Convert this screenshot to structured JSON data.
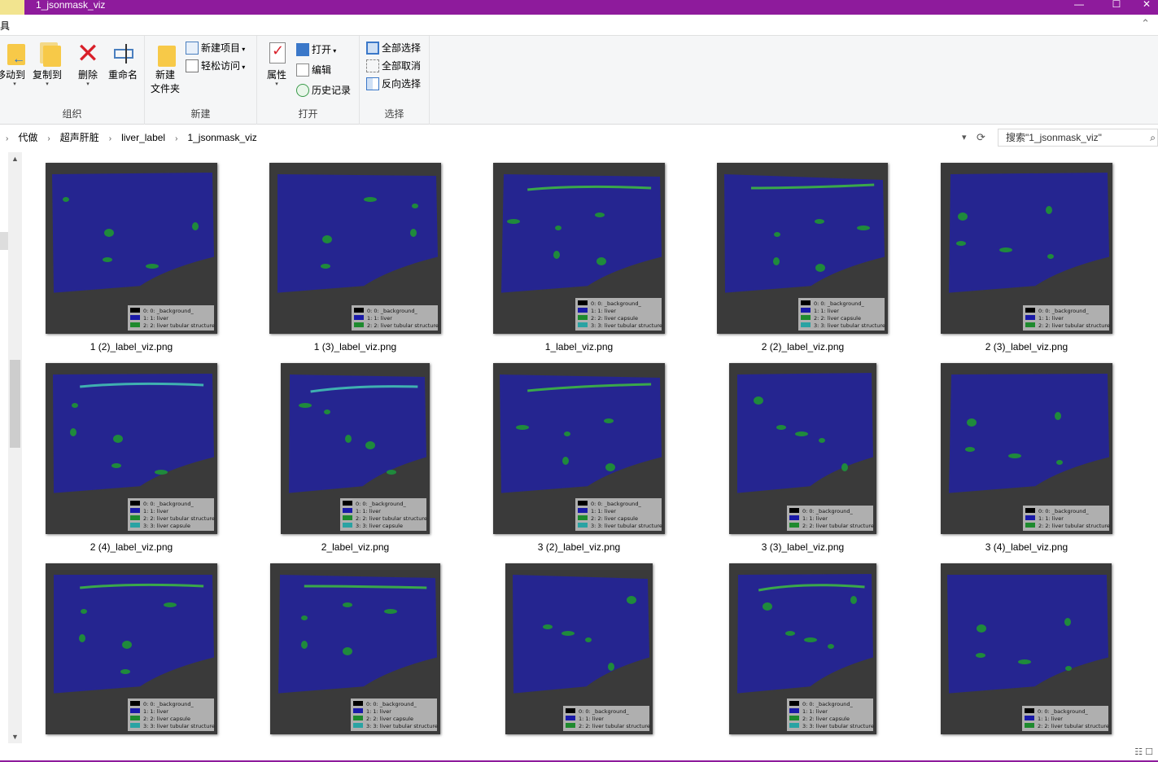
{
  "window": {
    "title": "1_jsonmask_viz"
  },
  "menu": {
    "tab_label": "工具"
  },
  "ribbon": {
    "groups": {
      "organize": "组织",
      "new": "新建",
      "open": "打开",
      "select": "选择"
    },
    "organize": {
      "move_to": "移动到",
      "copy_to": "复制到",
      "delete": "删除",
      "rename": "重命名"
    },
    "new": {
      "new_folder_line1": "新建",
      "new_folder_line2": "文件夹",
      "new_item": "新建项目",
      "easy_access": "轻松访问"
    },
    "open": {
      "properties": "属性",
      "open": "打开",
      "edit": "编辑",
      "history": "历史记录"
    },
    "select": {
      "select_all": "全部选择",
      "select_none": "全部取消",
      "invert": "反向选择"
    }
  },
  "breadcrumb": [
    "代做",
    "超声肝脏",
    "liver_label",
    "1_jsonmask_viz"
  ],
  "search": {
    "placeholder": "搜索\"1_jsonmask_viz\""
  },
  "legend_text": {
    "bg": "0: 0: _background_",
    "liver": "1: 1: liver",
    "tub": "2: 2: liver tubular structure",
    "cap2": "2: 2: liver capsule",
    "cap3": "3: 3: liver capsule",
    "tub3": "3: 3: liver tubular structure"
  },
  "files": [
    {
      "name": "1 (2)_label_viz.png",
      "legend": [
        "bg",
        "liver",
        "tub"
      ]
    },
    {
      "name": "1 (3)_label_viz.png",
      "legend": [
        "bg",
        "liver",
        "tub"
      ]
    },
    {
      "name": "1_label_viz.png",
      "legend": [
        "bg",
        "liver",
        "cap2",
        "tub3"
      ]
    },
    {
      "name": "2 (2)_label_viz.png",
      "legend": [
        "bg",
        "liver",
        "cap2",
        "tub3"
      ]
    },
    {
      "name": "2 (3)_label_viz.png",
      "legend": [
        "bg",
        "liver",
        "tub"
      ]
    },
    {
      "name": "2 (4)_label_viz.png",
      "legend": [
        "bg",
        "liver",
        "tub",
        "cap3"
      ]
    },
    {
      "name": "2_label_viz.png",
      "legend": [
        "bg",
        "liver",
        "tub",
        "cap3"
      ]
    },
    {
      "name": "3 (2)_label_viz.png",
      "legend": [
        "bg",
        "liver",
        "cap2",
        "tub3"
      ]
    },
    {
      "name": "3 (3)_label_viz.png",
      "legend": [
        "bg",
        "liver",
        "tub"
      ]
    },
    {
      "name": "3 (4)_label_viz.png",
      "legend": [
        "bg",
        "liver",
        "tub"
      ]
    },
    {
      "name": "",
      "legend": [
        "bg",
        "liver",
        "cap2",
        "tub3"
      ]
    },
    {
      "name": "",
      "legend": [
        "bg",
        "liver",
        "cap2",
        "tub3"
      ]
    },
    {
      "name": "",
      "legend": [
        "bg",
        "liver",
        "tub"
      ]
    },
    {
      "name": "",
      "legend": [
        "bg",
        "liver",
        "cap2",
        "tub3"
      ]
    },
    {
      "name": "",
      "legend": [
        "bg",
        "liver",
        "tub"
      ]
    }
  ],
  "colors": {
    "title_bar": "#8e1b9c",
    "liver_overlay": "#23239a",
    "tubular": "#1f8a3c",
    "capsule": "#3fb0b0"
  }
}
